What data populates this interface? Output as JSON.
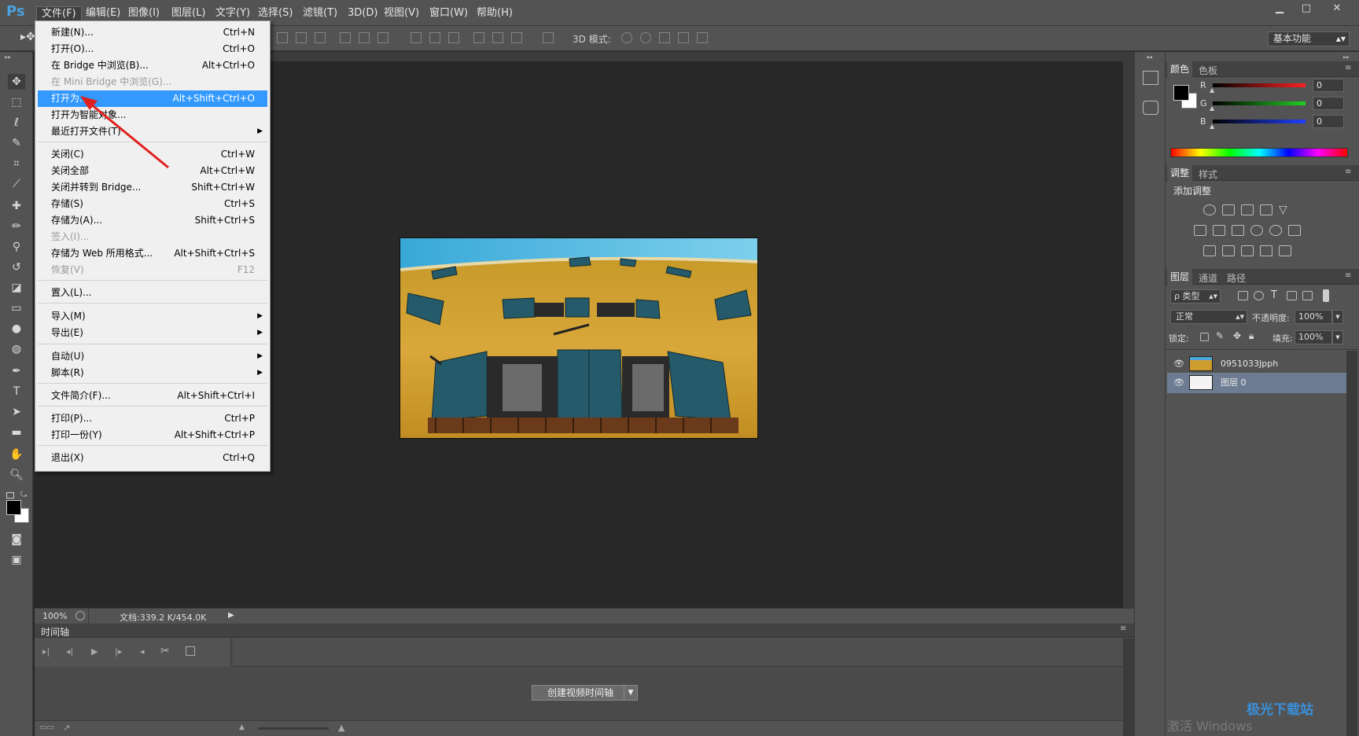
{
  "app": {
    "logo": "Ps"
  },
  "menubar": {
    "items": [
      "文件(F)",
      "编辑(E)",
      "图像(I)",
      "图层(L)",
      "文字(Y)",
      "选择(S)",
      "滤镜(T)",
      "3D(D)",
      "视图(V)",
      "窗口(W)",
      "帮助(H)"
    ],
    "active": "文件(F)"
  },
  "window_controls": {
    "minimize": "▁",
    "restore": "□",
    "close": "✕"
  },
  "optionsbar": {
    "mode_label": "3D 模式:",
    "workspace": "基本功能"
  },
  "file_menu": {
    "items": [
      {
        "label": "新建(N)...",
        "shortcut": "Ctrl+N"
      },
      {
        "label": "打开(O)...",
        "shortcut": "Ctrl+O"
      },
      {
        "label": "在 Bridge 中浏览(B)...",
        "shortcut": "Alt+Ctrl+O"
      },
      {
        "label": "在 Mini Bridge 中浏览(G)...",
        "shortcut": "",
        "disabled": true
      },
      {
        "label": "打开为...",
        "shortcut": "Alt+Shift+Ctrl+O",
        "highlighted": true
      },
      {
        "label": "打开为智能对象...",
        "shortcut": ""
      },
      {
        "label": "最近打开文件(T)",
        "shortcut": "",
        "submenu": true
      },
      {
        "label": "关闭(C)",
        "shortcut": "Ctrl+W"
      },
      {
        "label": "关闭全部",
        "shortcut": "Alt+Ctrl+W"
      },
      {
        "label": "关闭并转到 Bridge...",
        "shortcut": "Shift+Ctrl+W"
      },
      {
        "label": "存储(S)",
        "shortcut": "Ctrl+S"
      },
      {
        "label": "存储为(A)...",
        "shortcut": "Shift+Ctrl+S"
      },
      {
        "label": "签入(I)...",
        "shortcut": "",
        "disabled": true
      },
      {
        "label": "存储为 Web 所用格式...",
        "shortcut": "Alt+Shift+Ctrl+S"
      },
      {
        "label": "恢复(V)",
        "shortcut": "F12",
        "disabled": true
      },
      {
        "label": "置入(L)...",
        "shortcut": ""
      },
      {
        "label": "导入(M)",
        "shortcut": "",
        "submenu": true
      },
      {
        "label": "导出(E)",
        "shortcut": "",
        "submenu": true
      },
      {
        "label": "自动(U)",
        "shortcut": "",
        "submenu": true
      },
      {
        "label": "脚本(R)",
        "shortcut": "",
        "submenu": true
      },
      {
        "label": "文件简介(F)...",
        "shortcut": "Alt+Shift+Ctrl+I"
      },
      {
        "label": "打印(P)...",
        "shortcut": "Ctrl+P"
      },
      {
        "label": "打印一份(Y)",
        "shortcut": "Alt+Shift+Ctrl+P"
      },
      {
        "label": "退出(X)",
        "shortcut": "Ctrl+Q"
      }
    ]
  },
  "statusbar": {
    "zoom": "100%",
    "doc_info": "文档:339.2 K/454.0K"
  },
  "timeline": {
    "tab": "时间轴",
    "create_button": "创建视频时间轴"
  },
  "color_panel": {
    "tabs": [
      "颜色",
      "色板"
    ],
    "channels": [
      {
        "name": "R",
        "value": "0",
        "color": "#ff2020"
      },
      {
        "name": "G",
        "value": "0",
        "color": "#20d020"
      },
      {
        "name": "B",
        "value": "0",
        "color": "#2040ff"
      }
    ]
  },
  "adjust_panel": {
    "tabs": [
      "调整",
      "样式"
    ],
    "heading": "添加调整"
  },
  "layers_panel": {
    "tabs": [
      "图层",
      "通道",
      "路径"
    ],
    "filter_label": "ρ 类型",
    "blend_mode": "正常",
    "opacity_label": "不透明度:",
    "opacity_value": "100%",
    "lock_label": "锁定:",
    "fill_label": "填充:",
    "fill_value": "100%",
    "layers": [
      {
        "name": "0951033Jpph",
        "selected": false
      },
      {
        "name": "图层 0",
        "selected": true
      }
    ]
  },
  "watermark": {
    "text": "激活 Windows",
    "site": "极光下载站"
  }
}
